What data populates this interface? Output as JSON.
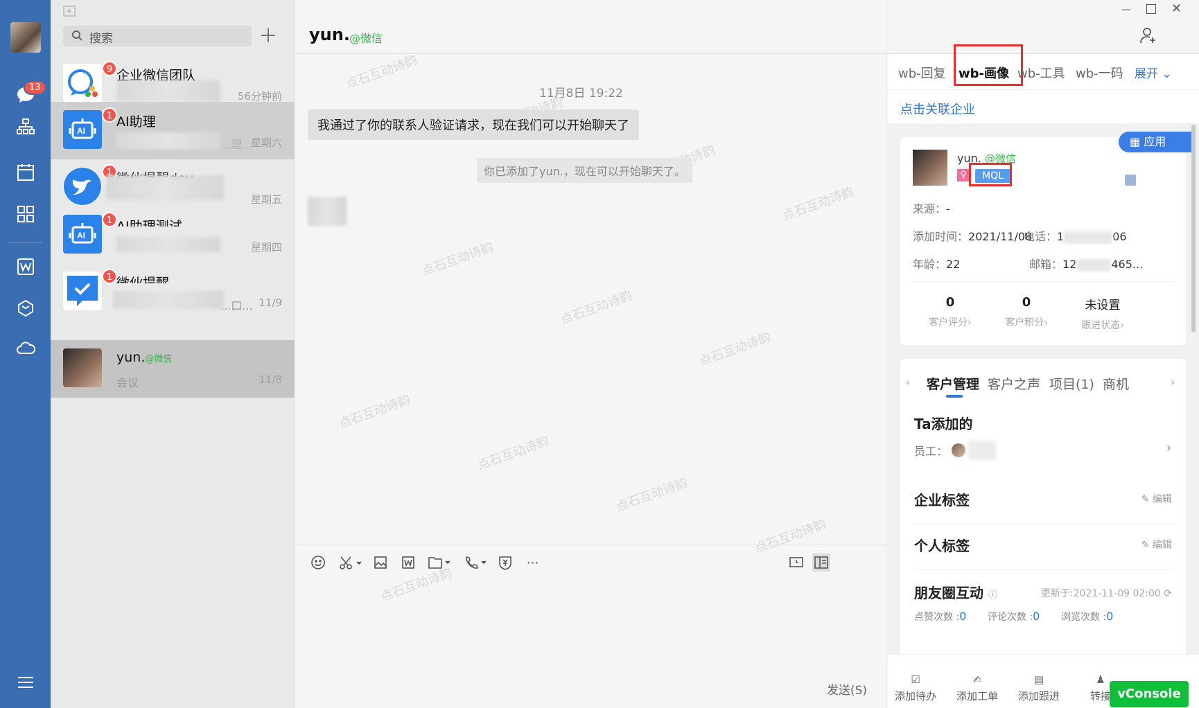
{
  "rail": {
    "message_badge": "13"
  },
  "search": {
    "placeholder": "搜索"
  },
  "conversations": [
    {
      "name": "企业微信团队",
      "time": "56分钟前",
      "badge": "9",
      "preview": ""
    },
    {
      "name": "AI助理",
      "time": "星期六",
      "badge": "1",
      "preview": "...理..."
    },
    {
      "name": "微伙提醒dev",
      "time": "星期五",
      "badge": "1",
      "preview": ""
    },
    {
      "name": "AI助理测试",
      "time": "星期四",
      "badge": "1",
      "preview": ""
    },
    {
      "name": "微伙提醒",
      "time": "11/9",
      "badge": "1",
      "preview": "...口..."
    },
    {
      "name": "yun.",
      "wechat_tag": "@微信",
      "time": "11/8",
      "badge": "",
      "preview": "会议"
    }
  ],
  "chat": {
    "title": "yun.",
    "title_tag": "@微信",
    "timestamp": "11月8日 19:22",
    "message": "我通过了你的联系人验证请求，现在我们可以开始聊天了",
    "system": "你已添加了yun.，现在可以开始聊天了。",
    "watermark": "点石互动诗韵",
    "send": "发送(S)"
  },
  "side": {
    "tabs": [
      "wb-回复",
      "wb-画像",
      "wb-工具",
      "wb-一码"
    ],
    "expand": "展开",
    "link_company": "点击关联企业",
    "app_button": "应用",
    "profile": {
      "name": "yun.",
      "tag": "@微信",
      "stage": "MQL",
      "source_label": "来源：",
      "source": "-",
      "added_label": "添加时间：",
      "added": "2021/11/08",
      "phone_label": "电话：",
      "phone_head": "1",
      "phone_tail": "06",
      "age_label": "年龄：",
      "age": "22",
      "email_label": "邮箱：",
      "email_head": "12",
      "email_tail": "465..."
    },
    "stats": [
      {
        "value": "0",
        "caption": "客户评分›"
      },
      {
        "value": "0",
        "caption": "客户积分›"
      },
      {
        "value": "未设置",
        "caption": "跟进状态›"
      }
    ],
    "subtabs": [
      "客户管理",
      "客户之声",
      "项目(1)",
      "商机"
    ],
    "ta_added": "Ta添加的",
    "employee_label": "员工：",
    "corp_tags": "企业标签",
    "personal_tags": "个人标签",
    "edit": "编辑",
    "moments": "朋友圈互动",
    "updated": "更新于:2021-11-09 02:00",
    "moment_stats": [
      {
        "label": "点赞次数 :",
        "value": "0"
      },
      {
        "label": "评论次数 :",
        "value": "0"
      },
      {
        "label": "浏览次数 :",
        "value": "0"
      }
    ],
    "bottom": [
      "添加待办",
      "添加工单",
      "添加跟进",
      "转接"
    ],
    "vconsole": "vConsole"
  }
}
